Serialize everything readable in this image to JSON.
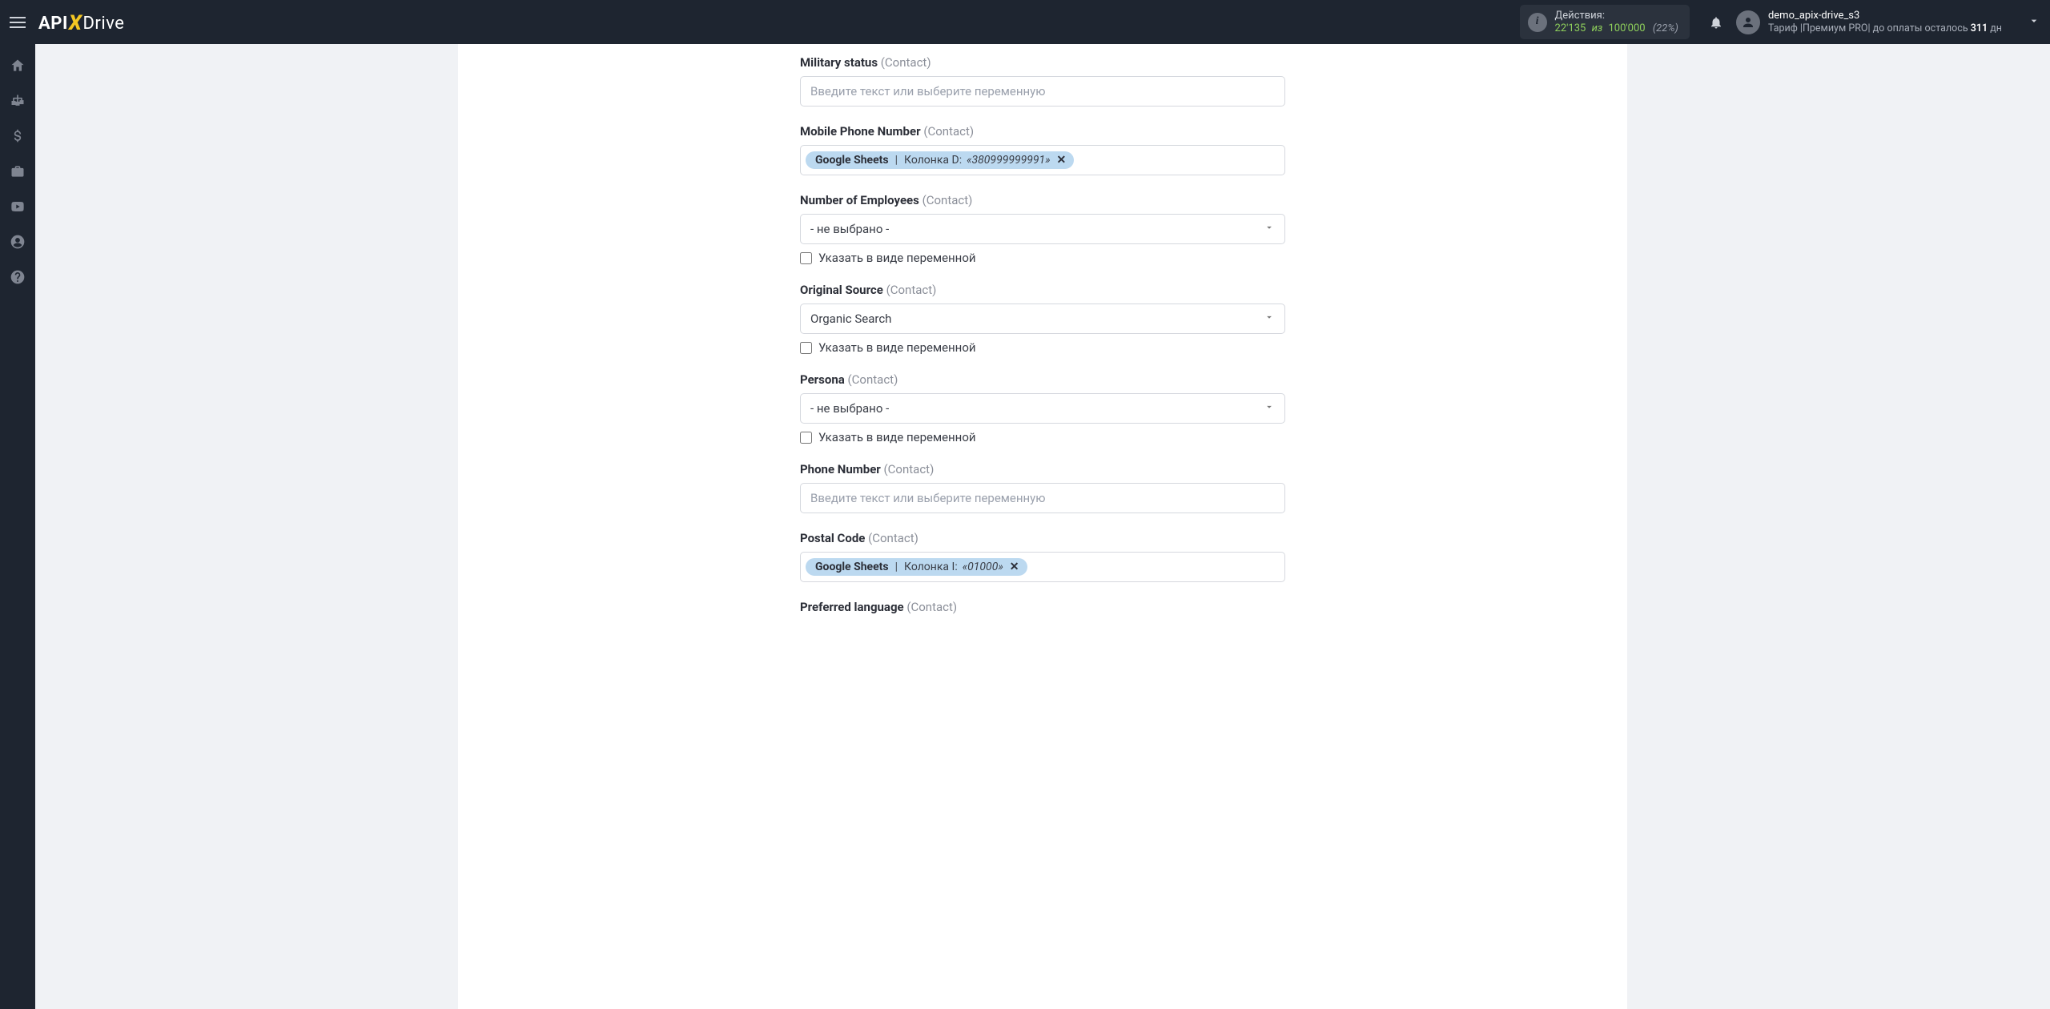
{
  "header": {
    "logo": {
      "api": "API",
      "x": "X",
      "drive": "Drive"
    },
    "actions": {
      "label": "Действия:",
      "current": "22'135",
      "of_word": "из",
      "total": "100'000",
      "percent": "(22%)"
    },
    "user": {
      "name": "demo_apix-drive_s3",
      "tariff_prefix": "Тариф |",
      "tariff_name": "Премиум PRO",
      "pay_prefix": "| до оплаты осталось ",
      "days": "311",
      "days_suffix": " дн"
    }
  },
  "sidebar_icons": [
    "home",
    "sitemap",
    "dollar",
    "briefcase",
    "youtube",
    "user",
    "help"
  ],
  "labels": {
    "contact_suffix": "(Contact)",
    "input_placeholder": "Введите текст или выберите переменную",
    "not_selected": "- не выбрано -",
    "as_variable": "Указать в виде переменной"
  },
  "fields": [
    {
      "key": "military_status",
      "label": "Military status",
      "type": "text"
    },
    {
      "key": "mobile_phone",
      "label": "Mobile Phone Number",
      "type": "chips",
      "chip": {
        "source": "Google Sheets",
        "column": "Колонка D:",
        "sample": "«380999999991»"
      }
    },
    {
      "key": "num_employees",
      "label": "Number of Employees",
      "type": "select",
      "value_key": "not_selected",
      "variable_checkbox": true
    },
    {
      "key": "original_source",
      "label": "Original Source",
      "type": "select",
      "value_literal": "Organic Search",
      "variable_checkbox": true
    },
    {
      "key": "persona",
      "label": "Persona",
      "type": "select",
      "value_key": "not_selected",
      "variable_checkbox": true
    },
    {
      "key": "phone_number",
      "label": "Phone Number",
      "type": "text"
    },
    {
      "key": "postal_code",
      "label": "Postal Code",
      "type": "chips",
      "chip": {
        "source": "Google Sheets",
        "column": "Колонка I:",
        "sample": "«01000»"
      }
    },
    {
      "key": "preferred_language",
      "label": "Preferred language",
      "type": "text",
      "no_input": true
    }
  ]
}
